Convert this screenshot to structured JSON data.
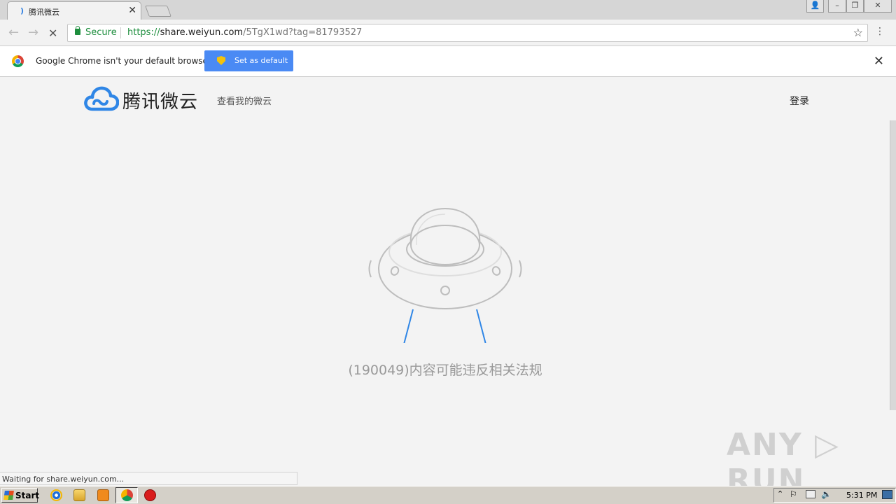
{
  "browser": {
    "tab_title": "腾讯微云",
    "tab_close": "✕",
    "window_controls": [
      "👤",
      "–",
      "❐",
      "✕"
    ],
    "secure_label": "Secure",
    "url_protocol": "https://",
    "url_host": "share.weiyun.com",
    "url_path": "/5TgX1wd?tag=81793527",
    "star_icon": "☆",
    "menu_icon": "⋮",
    "back_icon": "←",
    "forward_icon": "→",
    "reload_icon": "✕"
  },
  "infobar": {
    "text": "Google Chrome isn't your default browser",
    "button_label": "Set as default",
    "close_icon": "✕"
  },
  "page": {
    "logo_text": "腾讯微云",
    "nav_link": "查看我的微云",
    "login": "登录",
    "message": "(190049)内容可能违反相关法规",
    "accent_color": "#2f86e6"
  },
  "statusbar": {
    "text": "Waiting for share.weiyun.com..."
  },
  "watermark": "ANY ▷ RUN",
  "taskbar": {
    "start_label": "Start",
    "clock": "5:31 PM"
  }
}
